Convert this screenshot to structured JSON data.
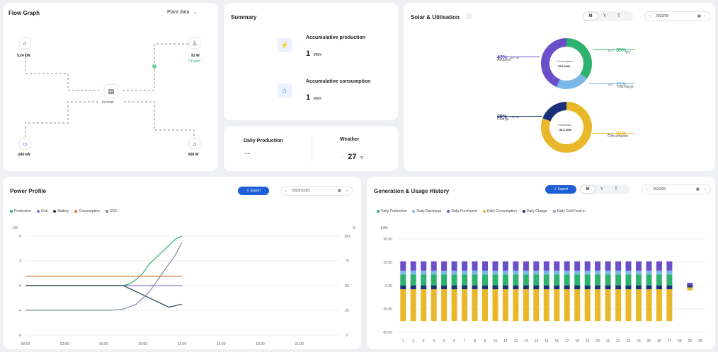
{
  "flow": {
    "title": "Flow Graph",
    "selector": "Plant data",
    "nodes": {
      "solar": {
        "value": "5.24 kW"
      },
      "grid": {
        "value": "91 W",
        "status": "On-grid"
      },
      "inverter": {
        "label": "Inverter"
      },
      "battery": {
        "value": "-185 kW"
      },
      "home": {
        "value": "800 W"
      }
    }
  },
  "summary": {
    "title": "Summary",
    "production": {
      "label": "Accumulative production",
      "value": "1",
      "unit": "MWh"
    },
    "consumption": {
      "label": "Accumulative consumption",
      "value": "1",
      "unit": "MWh"
    }
  },
  "daily": {
    "label": "Daily Production",
    "value": "--"
  },
  "weather": {
    "label": "Weather",
    "value": "27",
    "unit": "°C"
  },
  "solar_util": {
    "title": "Solar & Utilisation",
    "tabs": [
      "M",
      "Y",
      "T"
    ],
    "active_tab": "M",
    "date": "2023/09",
    "donut1": {
      "center_label": "Consumption",
      "center_value": "94.5 kWh",
      "left_pct": "43%",
      "left_val": "40.7 W",
      "left_label": "Adopted",
      "right_top_val": "34.3",
      "right_top_pct": "35%",
      "right_top_label": "PV",
      "right_bot_val": "26.8",
      "right_bot_pct": "21%",
      "right_bot_label": "Discharge"
    },
    "donut2": {
      "center_label": "Production",
      "center_value": "82.6 kWh",
      "left_pct": "20%",
      "left_val": "16.2 W",
      "left_label": "Charge",
      "right_val": "66.4",
      "right_pct": "81%",
      "right_label": "Consumption"
    }
  },
  "power_profile": {
    "title": "Power Profile",
    "export_label": "Export",
    "date": "2023/10/25",
    "legend": [
      {
        "label": "Production",
        "color": "#2db36f"
      },
      {
        "label": "Grid",
        "color": "#8a6cd6"
      },
      {
        "label": "Battery",
        "color": "#2c3e50"
      },
      {
        "label": "Consumption",
        "color": "#e07a3e"
      },
      {
        "label": "SOC",
        "color": "#888888"
      }
    ]
  },
  "history": {
    "title": "Generation & Usage History",
    "export_label": "Export",
    "tabs": [
      "M",
      "Y",
      "T"
    ],
    "active_tab": "M",
    "date": "2023/09",
    "legend": [
      {
        "label": "Daily Production",
        "color": "#2db36f"
      },
      {
        "label": "Daily Discharge",
        "color": "#7ab8e8"
      },
      {
        "label": "Daily Purchased",
        "color": "#6b4fc8"
      },
      {
        "label": "Daily Consumption",
        "color": "#e8b82a"
      },
      {
        "label": "Daily Charge",
        "color": "#1b2f7a"
      },
      {
        "label": "Daily Grid Feed-in",
        "color": "#a89ad6"
      }
    ]
  },
  "chart_data": [
    {
      "type": "line",
      "ylabel": "kW",
      "y2label": "%",
      "x_ticks": [
        "00:00",
        "03:00",
        "06:00",
        "09:00",
        "12:00",
        "15:00",
        "18:00",
        "21:00"
      ],
      "y_ticks": [
        8,
        4,
        0,
        -4,
        -8
      ],
      "y2_ticks": [
        100,
        75,
        50,
        25,
        0
      ],
      "ylim": [
        -8,
        8
      ],
      "x_range_hours": [
        0,
        24
      ],
      "series": [
        {
          "name": "Production",
          "color": "#2db36f",
          "x": [
            0,
            7.5,
            8,
            8.5,
            9,
            9.5,
            10,
            10.5,
            11,
            11.5,
            12
          ],
          "y": [
            0,
            0,
            0.3,
            1,
            2,
            3.5,
            4.5,
            5.5,
            6.5,
            7.5,
            8
          ]
        },
        {
          "name": "Grid",
          "color": "#8a6cd6",
          "x": [
            0,
            12
          ],
          "y": [
            0,
            0
          ]
        },
        {
          "name": "Battery",
          "color": "#2c3e50",
          "x": [
            0,
            7.5,
            8,
            9,
            10,
            11,
            12
          ],
          "y": [
            0,
            0,
            -0.5,
            -1.5,
            -2.5,
            -3.5,
            -3
          ]
        },
        {
          "name": "Consumption",
          "color": "#e07a3e",
          "x": [
            0,
            12
          ],
          "y": [
            1.5,
            1.5
          ]
        },
        {
          "name": "SOC",
          "color": "#7f8ca6",
          "x": [
            0,
            6.5,
            7.5,
            8.5,
            9.5,
            10.5,
            11.5,
            12
          ],
          "y": [
            -4,
            -4,
            -3.8,
            -3,
            -1,
            2,
            5,
            7
          ]
        }
      ]
    },
    {
      "type": "bar",
      "ylabel": "kWh",
      "y_ticks": [
        "50.00",
        "25.00",
        "0.00",
        "-25.00",
        "-50.00"
      ],
      "ylim": [
        -50,
        50
      ],
      "categories": [
        "1",
        "2",
        "3",
        "4",
        "5",
        "6",
        "7",
        "8",
        "9",
        "10",
        "11",
        "12",
        "13",
        "14",
        "15",
        "16",
        "17",
        "18",
        "19",
        "20",
        "21",
        "22",
        "23",
        "24",
        "25",
        "26",
        "27",
        "28",
        "29",
        "30"
      ],
      "series": [
        {
          "name": "Daily Production",
          "color": "#2db36f",
          "values": [
            12,
            12,
            12,
            12,
            12,
            12,
            12,
            12,
            12,
            12,
            12,
            12,
            12,
            12,
            12,
            12,
            12,
            12,
            12,
            12,
            12,
            12,
            12,
            12,
            12,
            12,
            12,
            0,
            0,
            0
          ]
        },
        {
          "name": "Daily Discharge",
          "color": "#7ab8e8",
          "values": [
            4,
            4,
            4,
            4,
            4,
            4,
            4,
            4,
            4,
            4,
            4,
            4,
            4,
            4,
            4,
            4,
            4,
            4,
            4,
            4,
            4,
            4,
            4,
            4,
            4,
            4,
            4,
            0,
            0,
            0
          ]
        },
        {
          "name": "Daily Purchased",
          "color": "#6b4fc8",
          "values": [
            10,
            10,
            10,
            10,
            10,
            10,
            10,
            10,
            10,
            10,
            10,
            10,
            10,
            10,
            10,
            10,
            10,
            10,
            10,
            10,
            10,
            10,
            10,
            10,
            10,
            10,
            10,
            0,
            3,
            0
          ]
        },
        {
          "name": "Daily Charge",
          "color": "#1b2f7a",
          "values": [
            -4,
            -4,
            -4,
            -4,
            -4,
            -4,
            -4,
            -4,
            -4,
            -4,
            -4,
            -4,
            -4,
            -4,
            -4,
            -4,
            -4,
            -4,
            -4,
            -4,
            -4,
            -4,
            -4,
            -4,
            -4,
            -4,
            -4,
            0,
            -2,
            0
          ]
        },
        {
          "name": "Daily Consumption",
          "color": "#e8b82a",
          "values": [
            -34,
            -34,
            -34,
            -34,
            -34,
            -34,
            -34,
            -34,
            -34,
            -34,
            -34,
            -34,
            -34,
            -34,
            -34,
            -34,
            -34,
            -34,
            -34,
            -34,
            -34,
            -34,
            -34,
            -34,
            -34,
            -34,
            -34,
            0,
            -3,
            0
          ]
        }
      ]
    }
  ]
}
